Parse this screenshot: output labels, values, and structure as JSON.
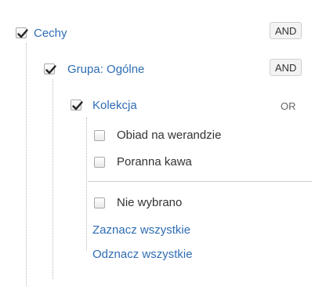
{
  "tree": {
    "root": {
      "label": "Cechy",
      "checked": true,
      "operator": "AND"
    },
    "group": {
      "label": "Grupa: Ogólne",
      "checked": true,
      "operator": "AND"
    },
    "collection": {
      "label": "Kolekcja",
      "checked": true,
      "operator": "OR"
    },
    "options": [
      {
        "label": "Obiad na werandzie",
        "checked": false
      },
      {
        "label": "Poranna kawa",
        "checked": false
      }
    ],
    "none_option": {
      "label": "Nie wybrano",
      "checked": false
    },
    "select_all": "Zaznacz wszystkie",
    "deselect_all": "Odznacz wszystkie"
  },
  "colors": {
    "link": "#2f6db4",
    "text": "#333333",
    "border": "#a9a9a9"
  }
}
